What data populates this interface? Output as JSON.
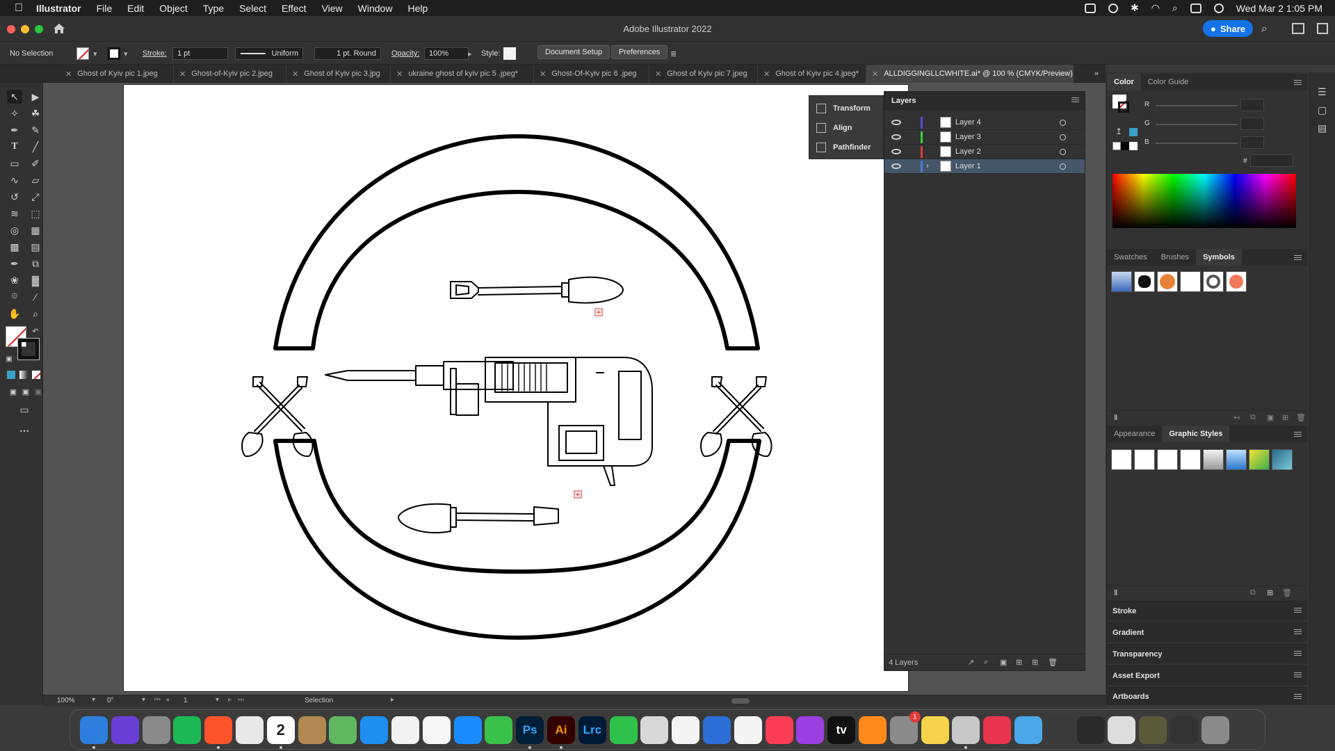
{
  "menubar": {
    "app_name": "Illustrator",
    "menus": [
      "File",
      "Edit",
      "Object",
      "Type",
      "Select",
      "Effect",
      "View",
      "Window",
      "Help"
    ],
    "datetime": "Wed Mar 2  1:05 PM"
  },
  "titlebar": {
    "title": "Adobe Illustrator 2022",
    "share_label": "Share"
  },
  "controlbar": {
    "selection_status": "No Selection",
    "stroke_label": "Stroke:",
    "stroke_value": "1 pt",
    "profile_value": "Uniform",
    "brush_value": "1 pt. Round",
    "opacity_label": "Opacity:",
    "opacity_value": "100%",
    "style_label": "Style:",
    "document_setup_label": "Document Setup",
    "preferences_label": "Preferences"
  },
  "tabs": [
    {
      "label": "Ghost of Kyiv pic 1.jpeg"
    },
    {
      "label": "Ghost-of-Kyiv pic 2.jpeg"
    },
    {
      "label": "Ghost of Kyiv pic 3.jpg"
    },
    {
      "label": "ukraine ghost of kyiv pic 5 .jpeg*"
    },
    {
      "label": "Ghost-Of-Kyiv pic 6 .jpeg"
    },
    {
      "label": "Ghost of Kyiv pic 7.jpeg"
    },
    {
      "label": "Ghost of Kyiv pic 4.jpeg*"
    },
    {
      "label": "ALLDIGGINGLLCWHITE.ai* @ 100 % (CMYK/Preview)"
    }
  ],
  "float_panels": {
    "items": [
      "Transform",
      "Align",
      "Pathfinder"
    ]
  },
  "layers": {
    "title": "Layers",
    "rows": [
      {
        "name": "Layer 4",
        "color": "#4f4fd6"
      },
      {
        "name": "Layer 3",
        "color": "#3ccf3c"
      },
      {
        "name": "Layer 2",
        "color": "#e03a3a"
      },
      {
        "name": "Layer 1",
        "color": "#4a7bd6"
      }
    ],
    "count_label": "4 Layers"
  },
  "color_panel": {
    "tabs": [
      "Color",
      "Color Guide"
    ],
    "channels": [
      "R",
      "G",
      "B"
    ],
    "hex_prefix": "#"
  },
  "symbols_panel": {
    "tabs": [
      "Swatches",
      "Brushes",
      "Symbols"
    ]
  },
  "appearance_panel": {
    "tabs": [
      "Appearance",
      "Graphic Styles"
    ]
  },
  "collapsed_panels": [
    "Stroke",
    "Gradient",
    "Transparency",
    "Asset Export",
    "Artboards"
  ],
  "statusbar": {
    "zoom": "100%",
    "rotation": "0°",
    "artboard_num": "1",
    "tool_name": "Selection"
  },
  "dock": {
    "items": [
      {
        "name": "Finder",
        "label": "",
        "color": "#2f7fe0"
      },
      {
        "name": "Siri",
        "label": "",
        "color": "#6a3fd6"
      },
      {
        "name": "Launchpad",
        "label": "",
        "color": "#8a8a8a"
      },
      {
        "name": "Spotify",
        "label": "",
        "color": "#1db954"
      },
      {
        "name": "Brave",
        "label": "",
        "color": "#fb542b"
      },
      {
        "name": "Chrome",
        "label": "",
        "color": "#e8e8e8"
      },
      {
        "name": "Calendar",
        "label": "2",
        "color": "#ffffff"
      },
      {
        "name": "Contacts",
        "label": "",
        "color": "#b08850"
      },
      {
        "name": "Maps",
        "label": "",
        "color": "#5fb85f"
      },
      {
        "name": "Safari",
        "label": "",
        "color": "#1e8ff0"
      },
      {
        "name": "Photos",
        "label": "",
        "color": "#f2f2f2"
      },
      {
        "name": "Reminders",
        "label": "",
        "color": "#f5f5f5"
      },
      {
        "name": "App Store",
        "label": "",
        "color": "#1a8cff"
      },
      {
        "name": "Messages",
        "label": "",
        "color": "#3ac24a"
      },
      {
        "name": "Photoshop",
        "label": "Ps",
        "color": "#001e36"
      },
      {
        "name": "Illustrator",
        "label": "Ai",
        "color": "#330000"
      },
      {
        "name": "Lightroom Classic",
        "label": "Lrc",
        "color": "#001a36"
      },
      {
        "name": "FaceTime",
        "label": "",
        "color": "#2fc24b"
      },
      {
        "name": "Preview",
        "label": "",
        "color": "#d8d8d8"
      },
      {
        "name": "Numbers",
        "label": "",
        "color": "#f4f4f4"
      },
      {
        "name": "Keynote",
        "label": "",
        "color": "#2c6fd6"
      },
      {
        "name": "News",
        "label": "",
        "color": "#f4f4f4"
      },
      {
        "name": "Music",
        "label": "",
        "color": "#fa3d55"
      },
      {
        "name": "Podcasts",
        "label": "",
        "color": "#9a3fe0"
      },
      {
        "name": "Apple TV",
        "label": "tv",
        "color": "#111111"
      },
      {
        "name": "Books",
        "label": "",
        "color": "#ff8a1a"
      },
      {
        "name": "System Preferences",
        "label": "",
        "color": "#8a8a8a"
      },
      {
        "name": "Notes",
        "label": "",
        "color": "#f7d34a"
      },
      {
        "name": "Screenshot",
        "label": "",
        "color": "#c8c8c8"
      },
      {
        "name": "Creative Cloud",
        "label": "",
        "color": "#e8344e"
      },
      {
        "name": "Folder",
        "label": "",
        "color": "#4aa8e8"
      },
      {
        "name": "Recent 1",
        "label": "",
        "color": "#3a3a3a"
      },
      {
        "name": "Recent 2",
        "label": "",
        "color": "#2a2a2a"
      },
      {
        "name": "Recent 3",
        "label": "",
        "color": "#dddddd"
      },
      {
        "name": "Recent 4",
        "label": "",
        "color": "#5a5a3a"
      },
      {
        "name": "Recent 5",
        "label": "",
        "color": "#333333"
      },
      {
        "name": "Trash",
        "label": "",
        "color": "#8a8a8a"
      }
    ],
    "settings_badge": "1"
  }
}
